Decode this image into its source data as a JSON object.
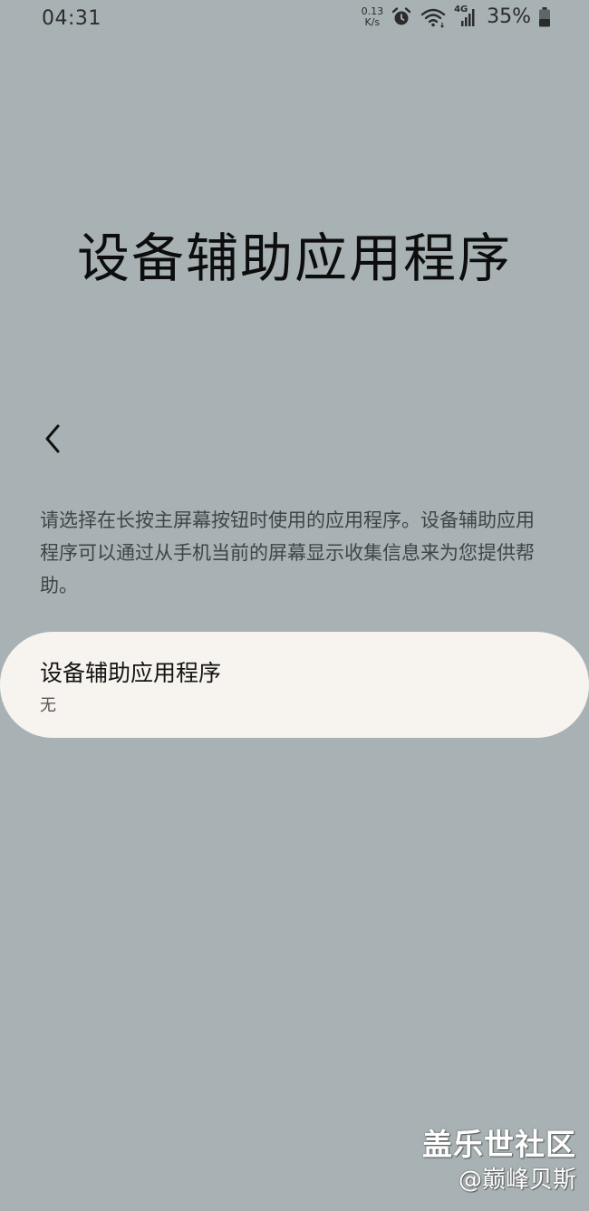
{
  "status_bar": {
    "time": "04:31",
    "net_speed_value": "0.13",
    "net_speed_unit": "K/s",
    "network_type": "4G",
    "battery": "35%",
    "icons": [
      "alarm-icon",
      "wifi-icon",
      "signal-icon",
      "battery-icon"
    ]
  },
  "page": {
    "title": "设备辅助应用程序",
    "description": "请选择在长按主屏幕按钮时使用的应用程序。设备辅助应用程序可以通过从手机当前的屏幕显示收集信息来为您提供帮助。"
  },
  "setting": {
    "title": "设备辅助应用程序",
    "value": "无"
  },
  "watermark": {
    "line1": "盖乐世社区",
    "line2": "@巅峰贝斯"
  },
  "colors": {
    "background": "#a8b2b4",
    "card": "#f7f3ef"
  }
}
